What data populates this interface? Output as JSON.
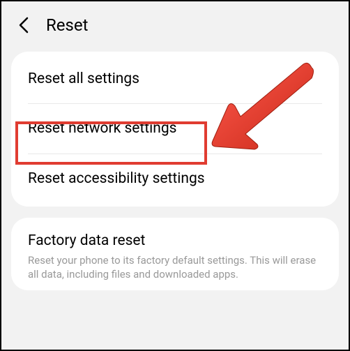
{
  "header": {
    "title": "Reset"
  },
  "resetOptions": {
    "items": [
      {
        "title": "Reset all settings"
      },
      {
        "title": "Reset network settings"
      },
      {
        "title": "Reset accessibility settings"
      }
    ]
  },
  "factoryReset": {
    "title": "Factory data reset",
    "subtitle": "Reset your phone to its factory default settings. This will erase all data, including files and downloaded apps."
  },
  "annotation": {
    "highlightColor": "#e03c31",
    "arrowColor": "#e03c31"
  }
}
